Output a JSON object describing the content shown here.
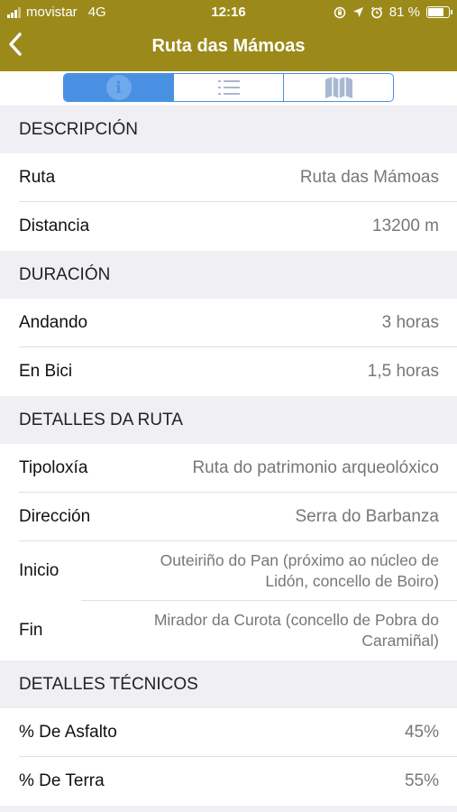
{
  "status": {
    "carrier": "movistar",
    "network": "4G",
    "time": "12:16",
    "battery_text": "81 %",
    "battery_level": 0.81
  },
  "nav": {
    "back_icon": "chevron-left-icon",
    "title": "Ruta das Mámoas"
  },
  "segments": [
    {
      "icon": "info-icon",
      "glyph": "i",
      "active": true
    },
    {
      "icon": "list-icon",
      "active": false
    },
    {
      "icon": "map-icon",
      "active": false
    }
  ],
  "sections": [
    {
      "header": "DESCRIPCIÓN",
      "rows": [
        {
          "label": "Ruta",
          "value": "Ruta das Mámoas"
        },
        {
          "label": "Distancia",
          "value": "13200 m"
        }
      ]
    },
    {
      "header": "DURACIÓN",
      "rows": [
        {
          "label": "Andando",
          "value": "3 horas"
        },
        {
          "label": "En Bici",
          "value": "1,5 horas"
        }
      ]
    },
    {
      "header": "DETALLES DA RUTA",
      "rows": [
        {
          "label": "Tipoloxía",
          "value": "Ruta do patrimonio arqueolóxico"
        },
        {
          "label": "Dirección",
          "value": "Serra do Barbanza"
        },
        {
          "label": "Inicio",
          "value": "Outeiriño do Pan (próximo ao núcleo de\nLidón, concello de Boiro)"
        },
        {
          "label": "Fin",
          "value": "Mirador da Curota (concello de Pobra do\nCaramiñal)"
        }
      ]
    },
    {
      "header": "DETALLES TÉCNICOS",
      "rows": [
        {
          "label": "% De Asfalto",
          "value": "45%"
        },
        {
          "label": "% De Terra",
          "value": "55%"
        }
      ]
    }
  ],
  "colors": {
    "brand": "#9b8a1a",
    "accent": "#4a90e2"
  }
}
